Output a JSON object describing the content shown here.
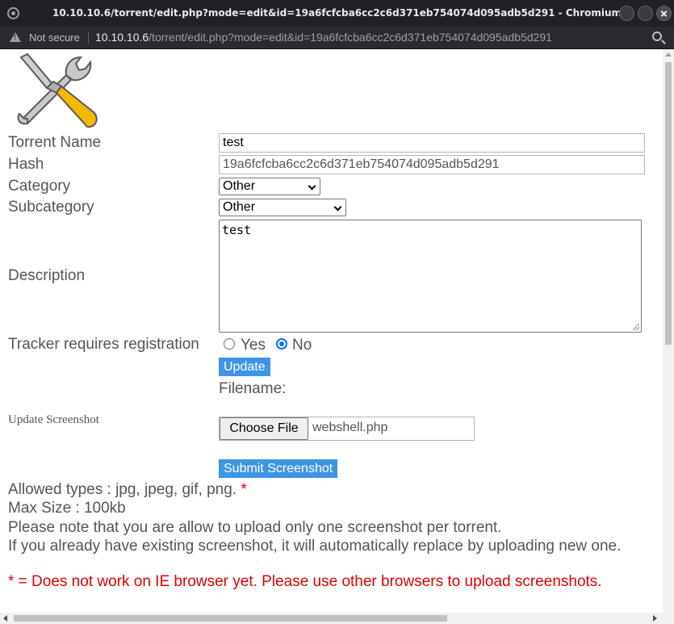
{
  "window": {
    "title": "10.10.10.6/torrent/edit.php?mode=edit&id=19a6fcfcba6cc2c6d371eb754074d095adb5d291 - Chromium"
  },
  "addressbar": {
    "security": "Not secure",
    "url_host": "10.10.10.6",
    "url_path": "/torrent/edit.php?mode=edit&id=19a6fcfcba6cc2c6d371eb754074d095adb5d291"
  },
  "form": {
    "torrent_name_label": "Torrent Name",
    "torrent_name_value": "test",
    "hash_label": "Hash",
    "hash_value": "19a6fcfcba6cc2c6d371eb754074d095adb5d291",
    "category_label": "Category",
    "category_value": "Other",
    "subcategory_label": "Subcategory",
    "subcategory_value": "Other",
    "description_label": "Description",
    "description_value": "test",
    "tracker_label": "Tracker requires registration",
    "tracker_options": [
      "Yes",
      "No"
    ],
    "tracker_selected": "No",
    "update_button": "Update",
    "filename_label": "Filename:"
  },
  "screenshot": {
    "label": "Update Screenshot",
    "choose_button": "Choose File",
    "file_name": "webshell.php",
    "submit_button": "Submit Screenshot"
  },
  "info": {
    "allowed_types": "Allowed types : jpg, jpeg, gif, png.",
    "asterisk": "*",
    "max_size": "Max Size : 100kb",
    "note_one": "Please note that you are allow to upload only one screenshot per torrent.",
    "note_replace": "If you already have existing screenshot, it will automatically replace by uploading new one.",
    "ie_warning": "* = Does not work on IE browser yet. Please use other browsers to upload screenshots."
  },
  "colors": {
    "button_blue": "#3e94e6",
    "warning_red": "#e00000",
    "radio_blue": "#0075ff"
  }
}
